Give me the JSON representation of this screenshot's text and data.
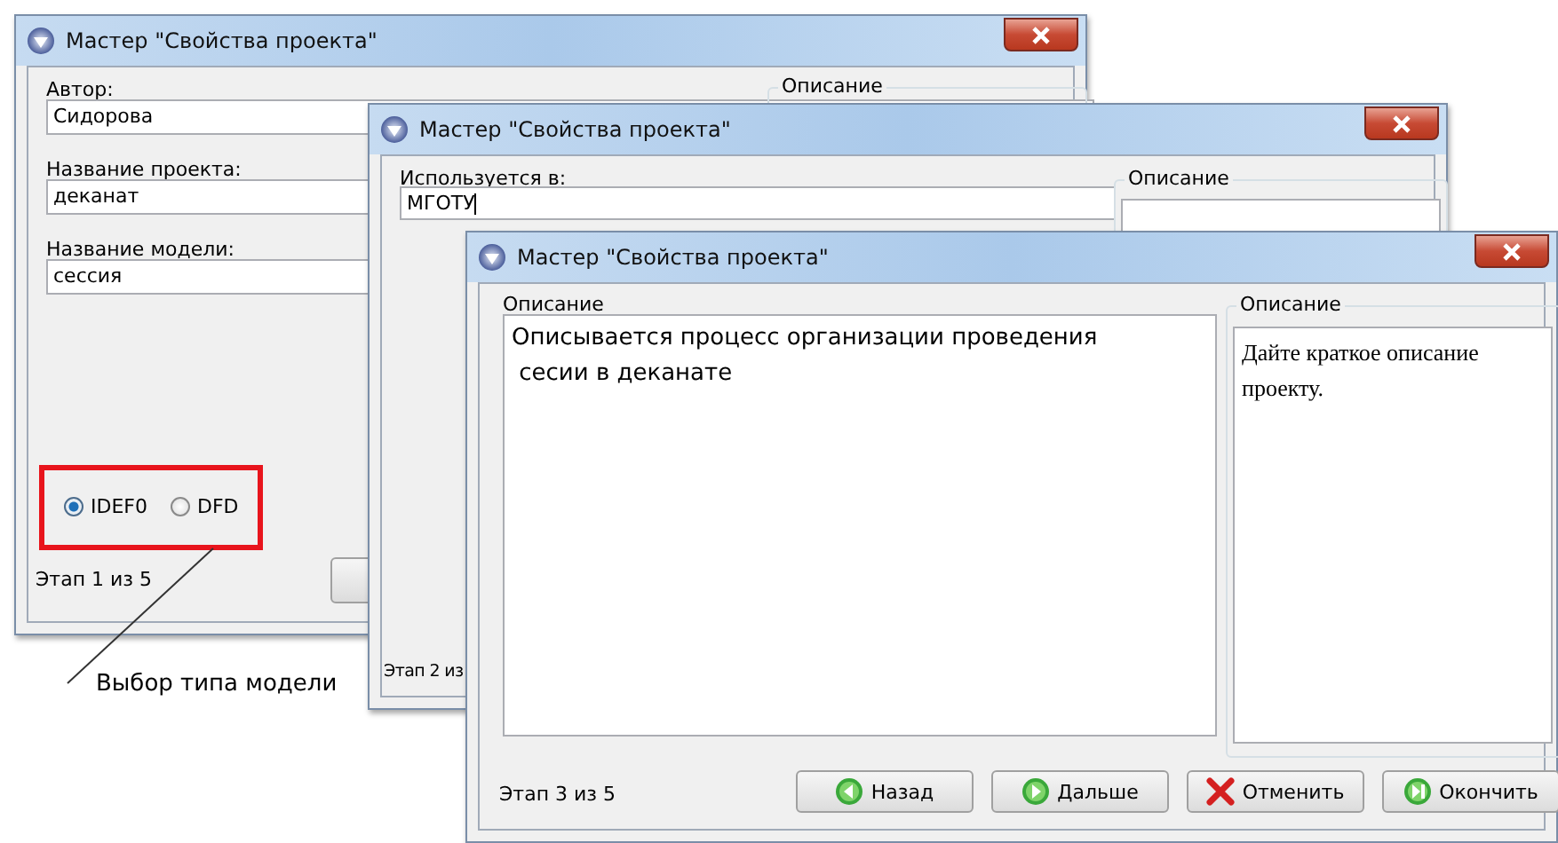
{
  "windows": [
    {
      "kind": "author",
      "title": "Мастер \"Свойства проекта\"",
      "fields": [
        {
          "label": "Автор:",
          "value": "Сидорова"
        },
        {
          "label": "Название проекта:",
          "value": "деканат"
        },
        {
          "label": "Название модели:",
          "value": "сессия"
        }
      ],
      "group_label": "Описание",
      "model_types": [
        {
          "label": "IDEF0",
          "selected": true
        },
        {
          "label": "DFD",
          "selected": false
        }
      ],
      "step": "Этап 1 из 5"
    },
    {
      "kind": "usage",
      "title": "Мастер \"Свойства проекта\"",
      "fields": [
        {
          "label": "Используется в:",
          "value": "МГОТУ"
        }
      ],
      "group_label": "Описание",
      "step": "Этап 2 из"
    },
    {
      "kind": "description",
      "title": "Мастер \"Свойства проекта\"",
      "description_label": "Описание",
      "description": "Описывается процесс организации проведения\n сесии в деканате",
      "group_label": "Описание",
      "hint": "Дайте краткое описание проекту.",
      "step": "Этап 3 из 5",
      "buttons": [
        {
          "label": "Назад",
          "kind": "back"
        },
        {
          "label": "Дальше",
          "kind": "next"
        },
        {
          "label": "Отменить",
          "kind": "cancel"
        },
        {
          "label": "Окончить",
          "kind": "finish"
        }
      ]
    }
  ],
  "annotation": "Выбор типа модели"
}
